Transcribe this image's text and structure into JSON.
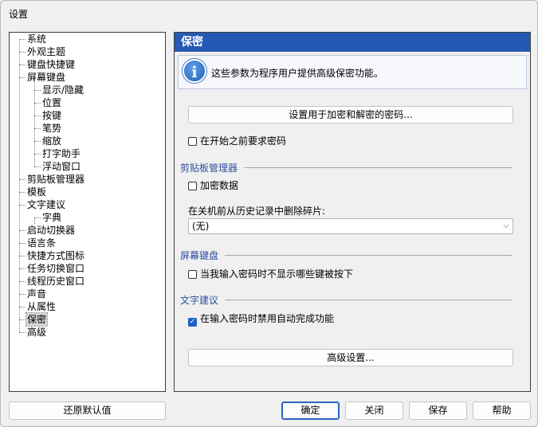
{
  "window": {
    "title": "设置"
  },
  "tree": {
    "items": [
      {
        "label": "系统",
        "level": 0
      },
      {
        "label": "外观主题",
        "level": 0
      },
      {
        "label": "键盘快捷键",
        "level": 0
      },
      {
        "label": "屏幕键盘",
        "level": 0
      },
      {
        "label": "显示/隐藏",
        "level": 1
      },
      {
        "label": "位置",
        "level": 1
      },
      {
        "label": "按键",
        "level": 1
      },
      {
        "label": "笔势",
        "level": 1
      },
      {
        "label": "缩放",
        "level": 1
      },
      {
        "label": "打字助手",
        "level": 1
      },
      {
        "label": "浮动窗口",
        "level": 1
      },
      {
        "label": "剪贴板管理器",
        "level": 0
      },
      {
        "label": "模板",
        "level": 0
      },
      {
        "label": "文字建议",
        "level": 0
      },
      {
        "label": "字典",
        "level": 1
      },
      {
        "label": "启动切换器",
        "level": 0
      },
      {
        "label": "语言条",
        "level": 0
      },
      {
        "label": "快捷方式图标",
        "level": 0
      },
      {
        "label": "任务切换窗口",
        "level": 0
      },
      {
        "label": "线程历史窗口",
        "level": 0
      },
      {
        "label": "声音",
        "level": 0
      },
      {
        "label": "从属性",
        "level": 0
      },
      {
        "label": "保密",
        "level": 0,
        "selected": true
      },
      {
        "label": "高级",
        "level": 0
      }
    ]
  },
  "panel": {
    "title": "保密",
    "info_text": "这些参数为程序用户提供高级保密功能。",
    "set_password_button": "设置用于加密和解密的密码...",
    "require_password_on_start": {
      "label": "在开始之前要求密码",
      "checked": false
    },
    "clipboard_section": "剪贴板管理器",
    "encrypt_data": {
      "label": "加密数据",
      "checked": false
    },
    "delete_history_label": "在关机前从历史记录中删除碎片:",
    "delete_history_select": "(无)",
    "osk_section": "屏幕键盘",
    "hide_keys_on_password": {
      "label": "当我输入密码时不显示哪些键被按下",
      "checked": false
    },
    "suggest_section": "文字建议",
    "disable_autocomplete": {
      "label": "在输入密码时禁用自动完成功能",
      "checked": true
    },
    "advanced_button": "高级设置..."
  },
  "footer": {
    "restore_defaults": "还原默认值",
    "ok": "确定",
    "close": "关闭",
    "save": "保存",
    "help": "帮助"
  },
  "colors": {
    "header_bg": "#2659b3",
    "section_text": "#2d4f9c",
    "checkbox_checked": "#1d5fc9"
  }
}
